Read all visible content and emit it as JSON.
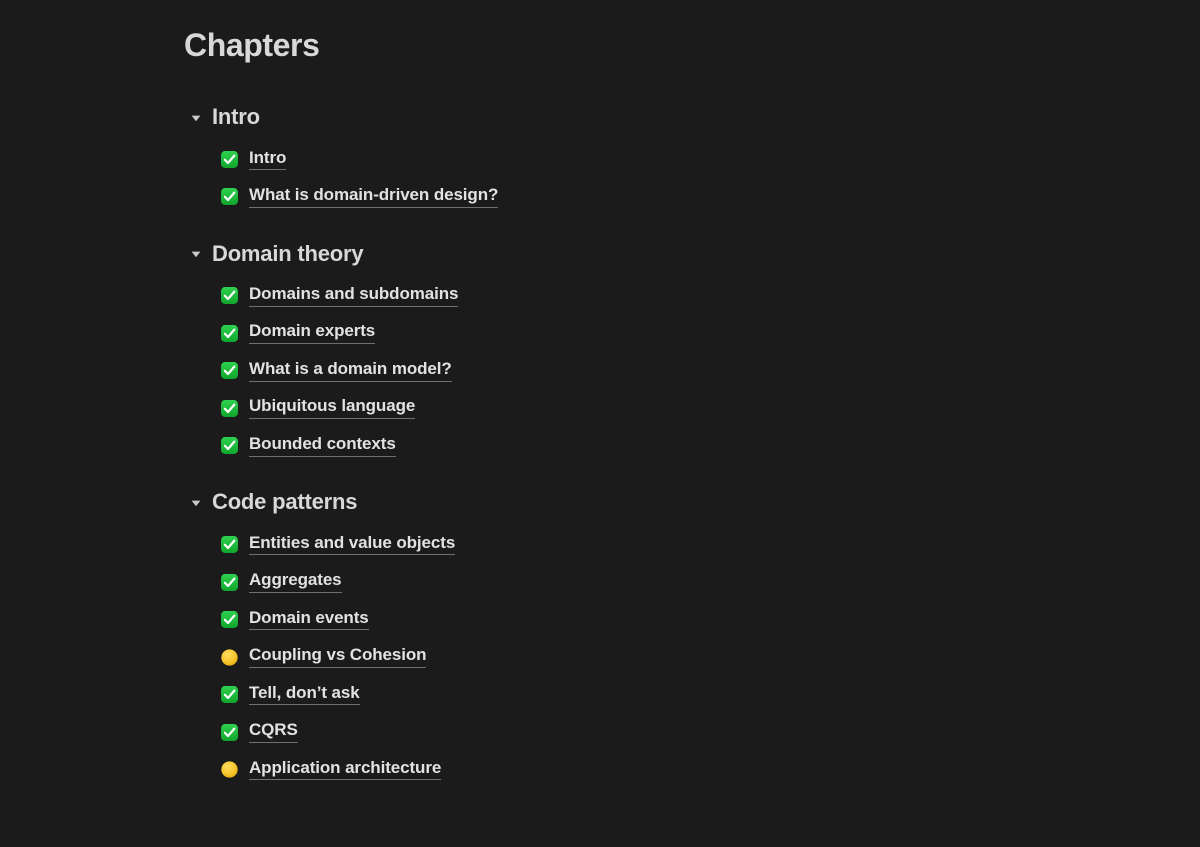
{
  "page": {
    "title": "Chapters",
    "background_color": "#1b1b1b",
    "text_color": "#d8d8d8",
    "link_color": "#e2e2e2",
    "underline_color": "#6f6f6f",
    "status_done_color": "#1db954",
    "status_pending_color": "#f5c32c"
  },
  "sections": [
    {
      "title": "Intro",
      "expanded": true,
      "disclosure_icon": "chevron-down-icon",
      "chapters": [
        {
          "label": "Intro",
          "status": "done",
          "status_icon": "check-mark-button-icon"
        },
        {
          "label": "What is domain-driven design?",
          "status": "done",
          "status_icon": "check-mark-button-icon"
        }
      ]
    },
    {
      "title": "Domain theory",
      "expanded": true,
      "disclosure_icon": "chevron-down-icon",
      "chapters": [
        {
          "label": "Domains and subdomains",
          "status": "done",
          "status_icon": "check-mark-button-icon"
        },
        {
          "label": "Domain experts",
          "status": "done",
          "status_icon": "check-mark-button-icon"
        },
        {
          "label": "What is a domain model?",
          "status": "done",
          "status_icon": "check-mark-button-icon"
        },
        {
          "label": "Ubiquitous language",
          "status": "done",
          "status_icon": "check-mark-button-icon"
        },
        {
          "label": "Bounded contexts",
          "status": "done",
          "status_icon": "check-mark-button-icon"
        }
      ]
    },
    {
      "title": "Code patterns",
      "expanded": true,
      "disclosure_icon": "chevron-down-icon",
      "chapters": [
        {
          "label": "Entities and value objects",
          "status": "done",
          "status_icon": "check-mark-button-icon"
        },
        {
          "label": "Aggregates",
          "status": "done",
          "status_icon": "check-mark-button-icon"
        },
        {
          "label": "Domain events",
          "status": "done",
          "status_icon": "check-mark-button-icon"
        },
        {
          "label": "Coupling vs Cohesion",
          "status": "pending",
          "status_icon": "yellow-circle-icon"
        },
        {
          "label": "Tell, don’t ask",
          "status": "done",
          "status_icon": "check-mark-button-icon"
        },
        {
          "label": "CQRS",
          "status": "done",
          "status_icon": "check-mark-button-icon"
        },
        {
          "label": "Application architecture",
          "status": "pending",
          "status_icon": "yellow-circle-icon"
        }
      ]
    }
  ]
}
